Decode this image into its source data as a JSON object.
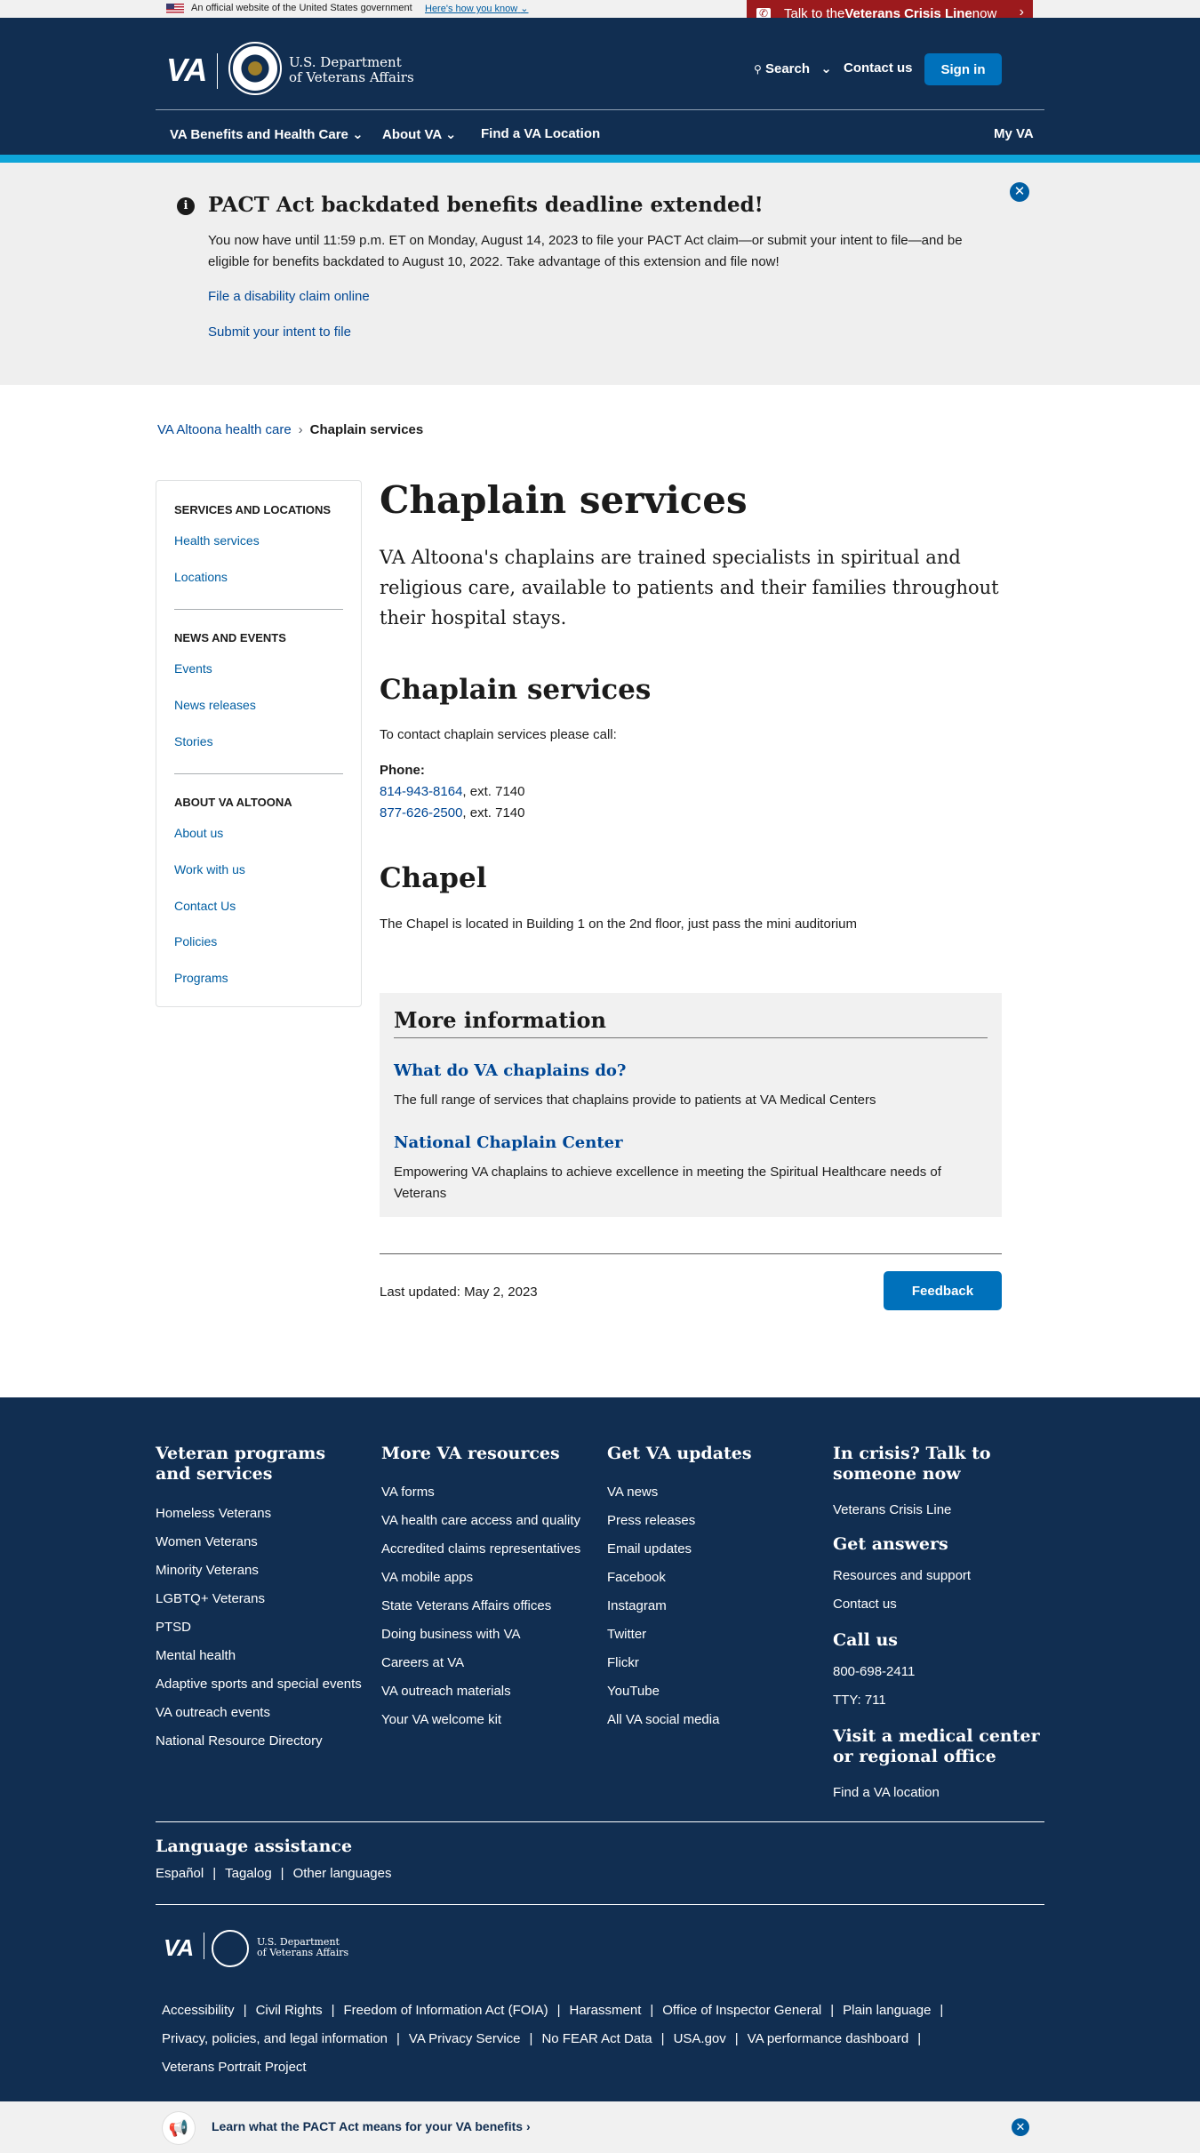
{
  "official_banner": {
    "text": "An official website of the United States government",
    "link": "Here's how you know"
  },
  "crisis_line": {
    "pre": "Talk to the ",
    "bold": "Veterans Crisis Line",
    "post": " now"
  },
  "header": {
    "logo": "VA",
    "dept_line1": "U.S. Department",
    "dept_line2": "of Veterans Affairs",
    "search": "Search",
    "contact": "Contact us",
    "sign_in": "Sign in",
    "nav": [
      "VA Benefits and Health Care",
      "About VA",
      "Find a VA Location",
      "My VA"
    ]
  },
  "promo": {
    "title": "PACT Act backdated benefits deadline extended!",
    "body": "You now have until 11:59 p.m. ET on Monday, August 14, 2023 to file your PACT Act claim—or submit your intent to file—and be eligible for benefits backdated to August 10, 2022. Take advantage of this extension and file now!",
    "link1": "File a disability claim online",
    "link2": "Submit your intent to file"
  },
  "breadcrumb": {
    "parent": "VA Altoona health care",
    "separator": "›",
    "current": "Chaplain services"
  },
  "sidenav": {
    "sections": [
      {
        "title": "SERVICES AND LOCATIONS",
        "items": [
          "Health services",
          "Locations"
        ]
      },
      {
        "title": "NEWS AND EVENTS",
        "items": [
          "Events",
          "News releases",
          "Stories"
        ]
      },
      {
        "title": "ABOUT VA ALTOONA",
        "items": [
          "About us",
          "Work with us",
          "Contact Us",
          "Policies",
          "Programs"
        ]
      }
    ]
  },
  "main": {
    "title": "Chaplain services",
    "intro": "VA Altoona's chaplains are trained specialists in spiritual and religious care, available to patients and their families throughout their hospital stays.",
    "section1_title": "Chaplain services",
    "section1_text": "To contact chaplain services please call:",
    "phone_label": "Phone:",
    "phones": [
      {
        "number": "814-943-8164",
        "ext": ", ext. 7140"
      },
      {
        "number": "877-626-2500",
        "ext": ", ext. 7140"
      }
    ],
    "section2_title": "Chapel",
    "section2_text": "The Chapel is located in Building 1 on the 2nd floor, just pass the mini auditorium",
    "more_info": {
      "title": "More information",
      "links": [
        {
          "label": "What do VA chaplains do?",
          "desc": "The full range of services that chaplains provide to patients at VA Medical Centers"
        },
        {
          "label": "National Chaplain Center",
          "desc": "Empowering VA chaplains to achieve excellence in meeting the Spiritual Healthcare needs of Veterans"
        }
      ]
    },
    "last_updated": "Last updated: May 2, 2023",
    "feedback": "Feedback"
  },
  "footer": {
    "col1": {
      "title": "Veteran programs and services",
      "links": [
        "Homeless Veterans",
        "Women Veterans",
        "Minority Veterans",
        "LGBTQ+ Veterans",
        "PTSD",
        "Mental health",
        "Adaptive sports and special events",
        "VA outreach events",
        "National Resource Directory"
      ]
    },
    "col2": {
      "title": "More VA resources",
      "links": [
        "VA forms",
        "VA health care access and quality",
        "Accredited claims representatives",
        "VA mobile apps",
        "State Veterans Affairs offices",
        "Doing business with VA",
        "Careers at VA",
        "VA outreach materials",
        "Your VA welcome kit"
      ]
    },
    "col3": {
      "title": "Get VA updates",
      "links": [
        "VA news",
        "Press releases",
        "Email updates",
        "Facebook",
        "Instagram",
        "Twitter",
        "Flickr",
        "YouTube",
        "All VA social media"
      ]
    },
    "col4": {
      "crisis_title": "In crisis? Talk to someone now",
      "crisis_link": "Veterans Crisis Line",
      "answers_title": "Get answers",
      "answers_links": [
        "Resources and support",
        "Contact us"
      ],
      "call_title": "Call us",
      "call_links": [
        "800-698-2411",
        "TTY: 711"
      ],
      "visit_title": "Visit a medical center or regional office",
      "visit_link": "Find a VA location"
    },
    "language": {
      "title": "Language assistance",
      "links": [
        "Español",
        "Tagalog",
        "Other languages"
      ]
    },
    "logo": "VA",
    "dept_line1": "U.S. Department",
    "dept_line2": "of Veterans Affairs",
    "legal_row1": [
      "Accessibility",
      "Civil Rights",
      "Freedom of Information Act (FOIA)",
      "Harassment",
      "Office of Inspector General",
      "Plain language"
    ],
    "legal_row2": [
      "Privacy, policies, and legal information",
      "VA Privacy Service",
      "No FEAR Act Data",
      "USA.gov",
      "VA performance dashboard"
    ],
    "legal_row3": [
      "Veterans Portrait Project"
    ]
  },
  "bottom_bar": {
    "text": "Learn what the PACT Act means for your VA benefits",
    "chevron": "›"
  },
  "colors": {
    "header_bg": "#112e51",
    "accent_blue": "#0071bb",
    "crisis_red": "#9c1a1d",
    "stripe": "#0ea5d8"
  },
  "icons": [
    "flag-icon",
    "crisis-line-icon",
    "chevron-right-icon",
    "search-icon",
    "chevron-down-icon",
    "info-icon",
    "close-icon",
    "megaphone-icon",
    "va-seal-icon"
  ]
}
